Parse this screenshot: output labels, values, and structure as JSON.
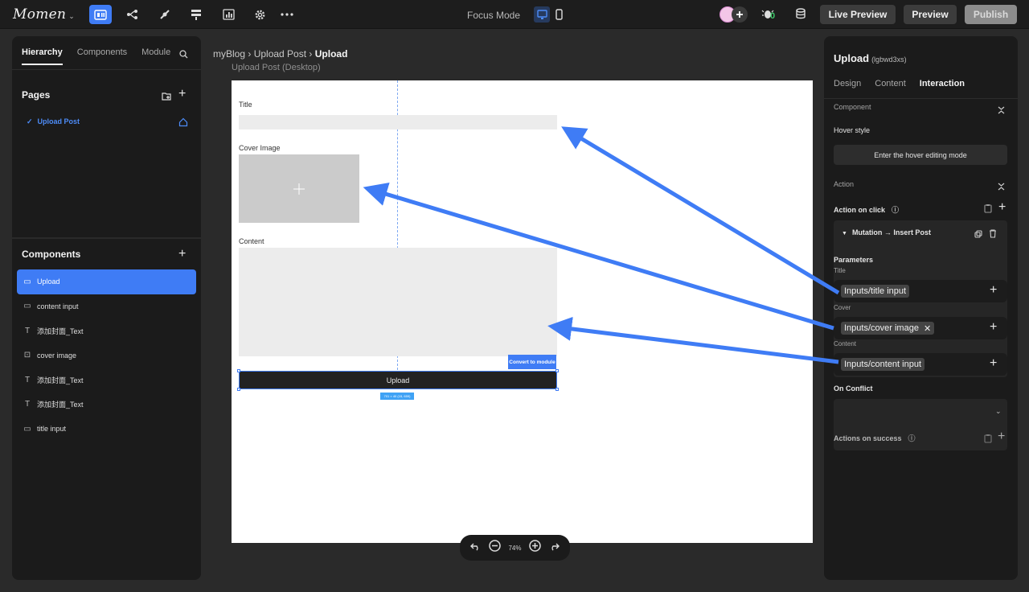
{
  "topbar": {
    "logo": "Momen",
    "focus_mode": "Focus Mode",
    "live_preview": "Live Preview",
    "preview": "Preview",
    "publish": "Publish",
    "notification_count": "0",
    "colors": {
      "accent": "#3f7cf5",
      "bg": "#1d1d1d"
    }
  },
  "left": {
    "tabs": [
      "Hierarchy",
      "Components",
      "Module"
    ],
    "pages_title": "Pages",
    "page_item": "Upload Post",
    "components_title": "Components",
    "components": [
      {
        "label": "Upload",
        "icon": "component-icon",
        "selected": true
      },
      {
        "label": "content input",
        "icon": "input-icon"
      },
      {
        "label": "添加封面_Text",
        "icon": "text-icon"
      },
      {
        "label": "cover image",
        "icon": "image-icon"
      },
      {
        "label": "添加封面_Text",
        "icon": "text-icon"
      },
      {
        "label": "添加封面_Text",
        "icon": "text-icon"
      },
      {
        "label": "title input",
        "icon": "input-icon"
      }
    ]
  },
  "breadcrumb": {
    "app": "myBlog",
    "page": "Upload Post",
    "current": "Upload"
  },
  "canvas": {
    "frame_label": "Upload Post (Desktop)",
    "title_label": "Title",
    "cover_label": "Cover Image",
    "content_label": "Content",
    "convert_btn": "Convert to module",
    "upload_btn": "Upload",
    "size_tag": "701 × 40 (15, 659)"
  },
  "zoom": {
    "level": "74%"
  },
  "right": {
    "title": "Upload",
    "id": "(lgbwd3xs)",
    "tabs": [
      "Design",
      "Content",
      "Interaction"
    ],
    "active_tab": "Interaction",
    "component_section": "Component",
    "hover_style": "Hover style",
    "hover_btn": "Enter the hover editing mode",
    "action_section": "Action",
    "action_on_click": "Action on click",
    "mutation": "Mutation → Insert Post",
    "parameters": "Parameters",
    "params": [
      {
        "label": "Title",
        "value": "Inputs/title input"
      },
      {
        "label": "Cover",
        "value": "Inputs/cover image"
      },
      {
        "label": "Content",
        "value": "Inputs/content input"
      }
    ],
    "on_conflict": "On Conflict",
    "actions_on_success": "Actions on success"
  }
}
